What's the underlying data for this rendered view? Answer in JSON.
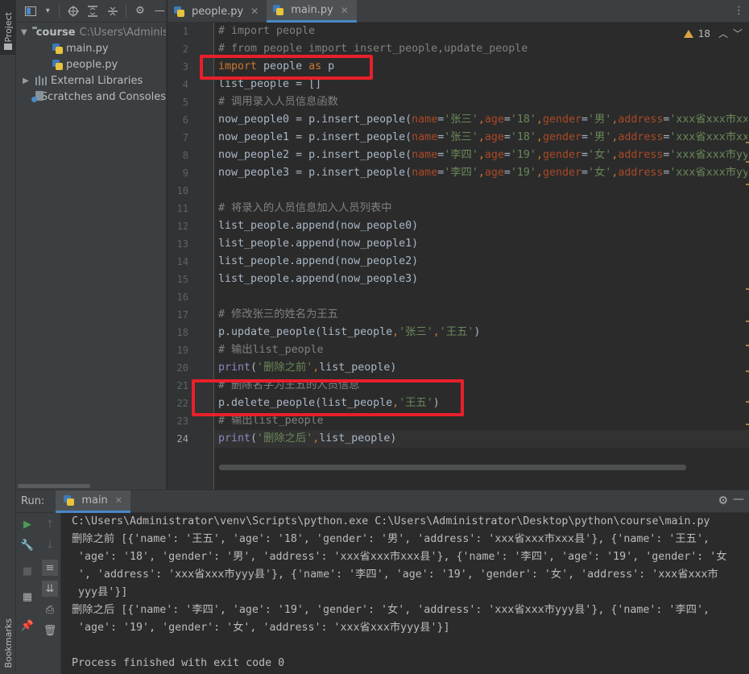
{
  "left_stripe": {
    "project_label": "Project",
    "bookmarks_label": "Bookmarks"
  },
  "project_pane": {
    "root_name": "course",
    "root_path": "C:\\Users\\Administrator",
    "files": [
      "main.py",
      "people.py"
    ],
    "external_libraries": "External Libraries",
    "scratches": "Scratches and Consoles"
  },
  "tabs": [
    {
      "label": "people.py",
      "active": false
    },
    {
      "label": "main.py",
      "active": true
    }
  ],
  "inspection": {
    "warning_count": "18"
  },
  "code_lines": [
    {
      "n": "1",
      "segs": [
        [
          "com",
          "# import people"
        ]
      ]
    },
    {
      "n": "2",
      "segs": [
        [
          "com",
          "# from people import insert_people,update_people"
        ]
      ]
    },
    {
      "n": "3",
      "segs": [
        [
          "kw",
          "import"
        ],
        [
          "txt",
          " people "
        ],
        [
          "kw",
          "as"
        ],
        [
          "txt",
          " p"
        ]
      ]
    },
    {
      "n": "4",
      "segs": [
        [
          "txt",
          "list_people = []"
        ]
      ]
    },
    {
      "n": "5",
      "segs": [
        [
          "com",
          "# 调用录入人员信息函数"
        ]
      ]
    },
    {
      "n": "6",
      "segs": [
        [
          "txt",
          "now_people0 = p.insert_people("
        ],
        [
          "par",
          "name"
        ],
        [
          "txt",
          "="
        ],
        [
          "str",
          "'张三'"
        ],
        [
          "kw",
          ","
        ],
        [
          "par",
          "age"
        ],
        [
          "txt",
          "="
        ],
        [
          "str",
          "'18'"
        ],
        [
          "kw",
          ","
        ],
        [
          "par",
          "gender"
        ],
        [
          "txt",
          "="
        ],
        [
          "str",
          "'男'"
        ],
        [
          "kw",
          ","
        ],
        [
          "par",
          "address"
        ],
        [
          "txt",
          "="
        ],
        [
          "str",
          "'xxx省xxx市xxx县'"
        ]
      ]
    },
    {
      "n": "7",
      "segs": [
        [
          "txt",
          "now_people1 = p.insert_people("
        ],
        [
          "par",
          "name"
        ],
        [
          "txt",
          "="
        ],
        [
          "str",
          "'张三'"
        ],
        [
          "kw",
          ","
        ],
        [
          "par",
          "age"
        ],
        [
          "txt",
          "="
        ],
        [
          "str",
          "'18'"
        ],
        [
          "kw",
          ","
        ],
        [
          "par",
          "gender"
        ],
        [
          "txt",
          "="
        ],
        [
          "str",
          "'男'"
        ],
        [
          "kw",
          ","
        ],
        [
          "par",
          "address"
        ],
        [
          "txt",
          "="
        ],
        [
          "str",
          "'xxx省xxx市xxx县'"
        ]
      ]
    },
    {
      "n": "8",
      "segs": [
        [
          "txt",
          "now_people2 = p.insert_people("
        ],
        [
          "par",
          "name"
        ],
        [
          "txt",
          "="
        ],
        [
          "str",
          "'李四'"
        ],
        [
          "kw",
          ","
        ],
        [
          "par",
          "age"
        ],
        [
          "txt",
          "="
        ],
        [
          "str",
          "'19'"
        ],
        [
          "kw",
          ","
        ],
        [
          "par",
          "gender"
        ],
        [
          "txt",
          "="
        ],
        [
          "str",
          "'女'"
        ],
        [
          "kw",
          ","
        ],
        [
          "par",
          "address"
        ],
        [
          "txt",
          "="
        ],
        [
          "str",
          "'xxx省xxx市yyy县'"
        ]
      ]
    },
    {
      "n": "9",
      "segs": [
        [
          "txt",
          "now_people3 = p.insert_people("
        ],
        [
          "par",
          "name"
        ],
        [
          "txt",
          "="
        ],
        [
          "str",
          "'李四'"
        ],
        [
          "kw",
          ","
        ],
        [
          "par",
          "age"
        ],
        [
          "txt",
          "="
        ],
        [
          "str",
          "'19'"
        ],
        [
          "kw",
          ","
        ],
        [
          "par",
          "gender"
        ],
        [
          "txt",
          "="
        ],
        [
          "str",
          "'女'"
        ],
        [
          "kw",
          ","
        ],
        [
          "par",
          "address"
        ],
        [
          "txt",
          "="
        ],
        [
          "str",
          "'xxx省xxx市yyy县'"
        ]
      ]
    },
    {
      "n": "10",
      "segs": []
    },
    {
      "n": "11",
      "segs": [
        [
          "com",
          "# 将录入的人员信息加入人员列表中"
        ]
      ]
    },
    {
      "n": "12",
      "segs": [
        [
          "txt",
          "list_people.append(now_people0)"
        ]
      ]
    },
    {
      "n": "13",
      "segs": [
        [
          "txt",
          "list_people.append(now_people1)"
        ]
      ]
    },
    {
      "n": "14",
      "segs": [
        [
          "txt",
          "list_people.append(now_people2)"
        ]
      ]
    },
    {
      "n": "15",
      "segs": [
        [
          "txt",
          "list_people.append(now_people3)"
        ]
      ]
    },
    {
      "n": "16",
      "segs": []
    },
    {
      "n": "17",
      "segs": [
        [
          "com",
          "# 修改张三的姓名为王五"
        ]
      ]
    },
    {
      "n": "18",
      "segs": [
        [
          "txt",
          "p.update_people(list_people"
        ],
        [
          "kw",
          ","
        ],
        [
          "str",
          "'张三'"
        ],
        [
          "kw",
          ","
        ],
        [
          "str",
          "'王五'"
        ],
        [
          "txt",
          ")"
        ]
      ]
    },
    {
      "n": "19",
      "segs": [
        [
          "com",
          "# 输出list_people"
        ]
      ]
    },
    {
      "n": "20",
      "segs": [
        [
          "fn",
          "print"
        ],
        [
          "txt",
          "("
        ],
        [
          "str",
          "'删除之前'"
        ],
        [
          "kw",
          ","
        ],
        [
          "txt",
          "list_people)"
        ]
      ]
    },
    {
      "n": "21",
      "segs": [
        [
          "com",
          "# 删除名字为王五的人员信息"
        ]
      ]
    },
    {
      "n": "22",
      "segs": [
        [
          "txt",
          "p.delete_people(list_people"
        ],
        [
          "kw",
          ","
        ],
        [
          "str",
          "'王五'"
        ],
        [
          "txt",
          ")"
        ]
      ]
    },
    {
      "n": "23",
      "segs": [
        [
          "com",
          "# 输出list_people"
        ]
      ]
    },
    {
      "n": "24",
      "segs": [
        [
          "fn",
          "print"
        ],
        [
          "txt",
          "("
        ],
        [
          "str",
          "'删除之后'"
        ],
        [
          "kw",
          ","
        ],
        [
          "txt",
          "list_people)"
        ]
      ]
    }
  ],
  "run_panel": {
    "label": "Run:",
    "tab": "main",
    "console_lines": [
      "C:\\Users\\Administrator\\venv\\Scripts\\python.exe C:\\Users\\Administrator\\Desktop\\python\\course\\main.py",
      "删除之前 [{'name': '王五', 'age': '18', 'gender': '男', 'address': 'xxx省xxx市xxx县'}, {'name': '王五',",
      " 'age': '18', 'gender': '男', 'address': 'xxx省xxx市xxx县'}, {'name': '李四', 'age': '19', 'gender': '女",
      " ', 'address': 'xxx省xxx市yyy县'}, {'name': '李四', 'age': '19', 'gender': '女', 'address': 'xxx省xxx市",
      " yyy县'}]",
      "删除之后 [{'name': '李四', 'age': '19', 'gender': '女', 'address': 'xxx省xxx市yyy县'}, {'name': '李四',",
      " 'age': '19', 'gender': '女', 'address': 'xxx省xxx市yyy县'}]",
      "",
      "Process finished with exit code 0"
    ]
  },
  "colors": {
    "annotation_box": "#e8202a",
    "accent": "#4a88c7"
  }
}
